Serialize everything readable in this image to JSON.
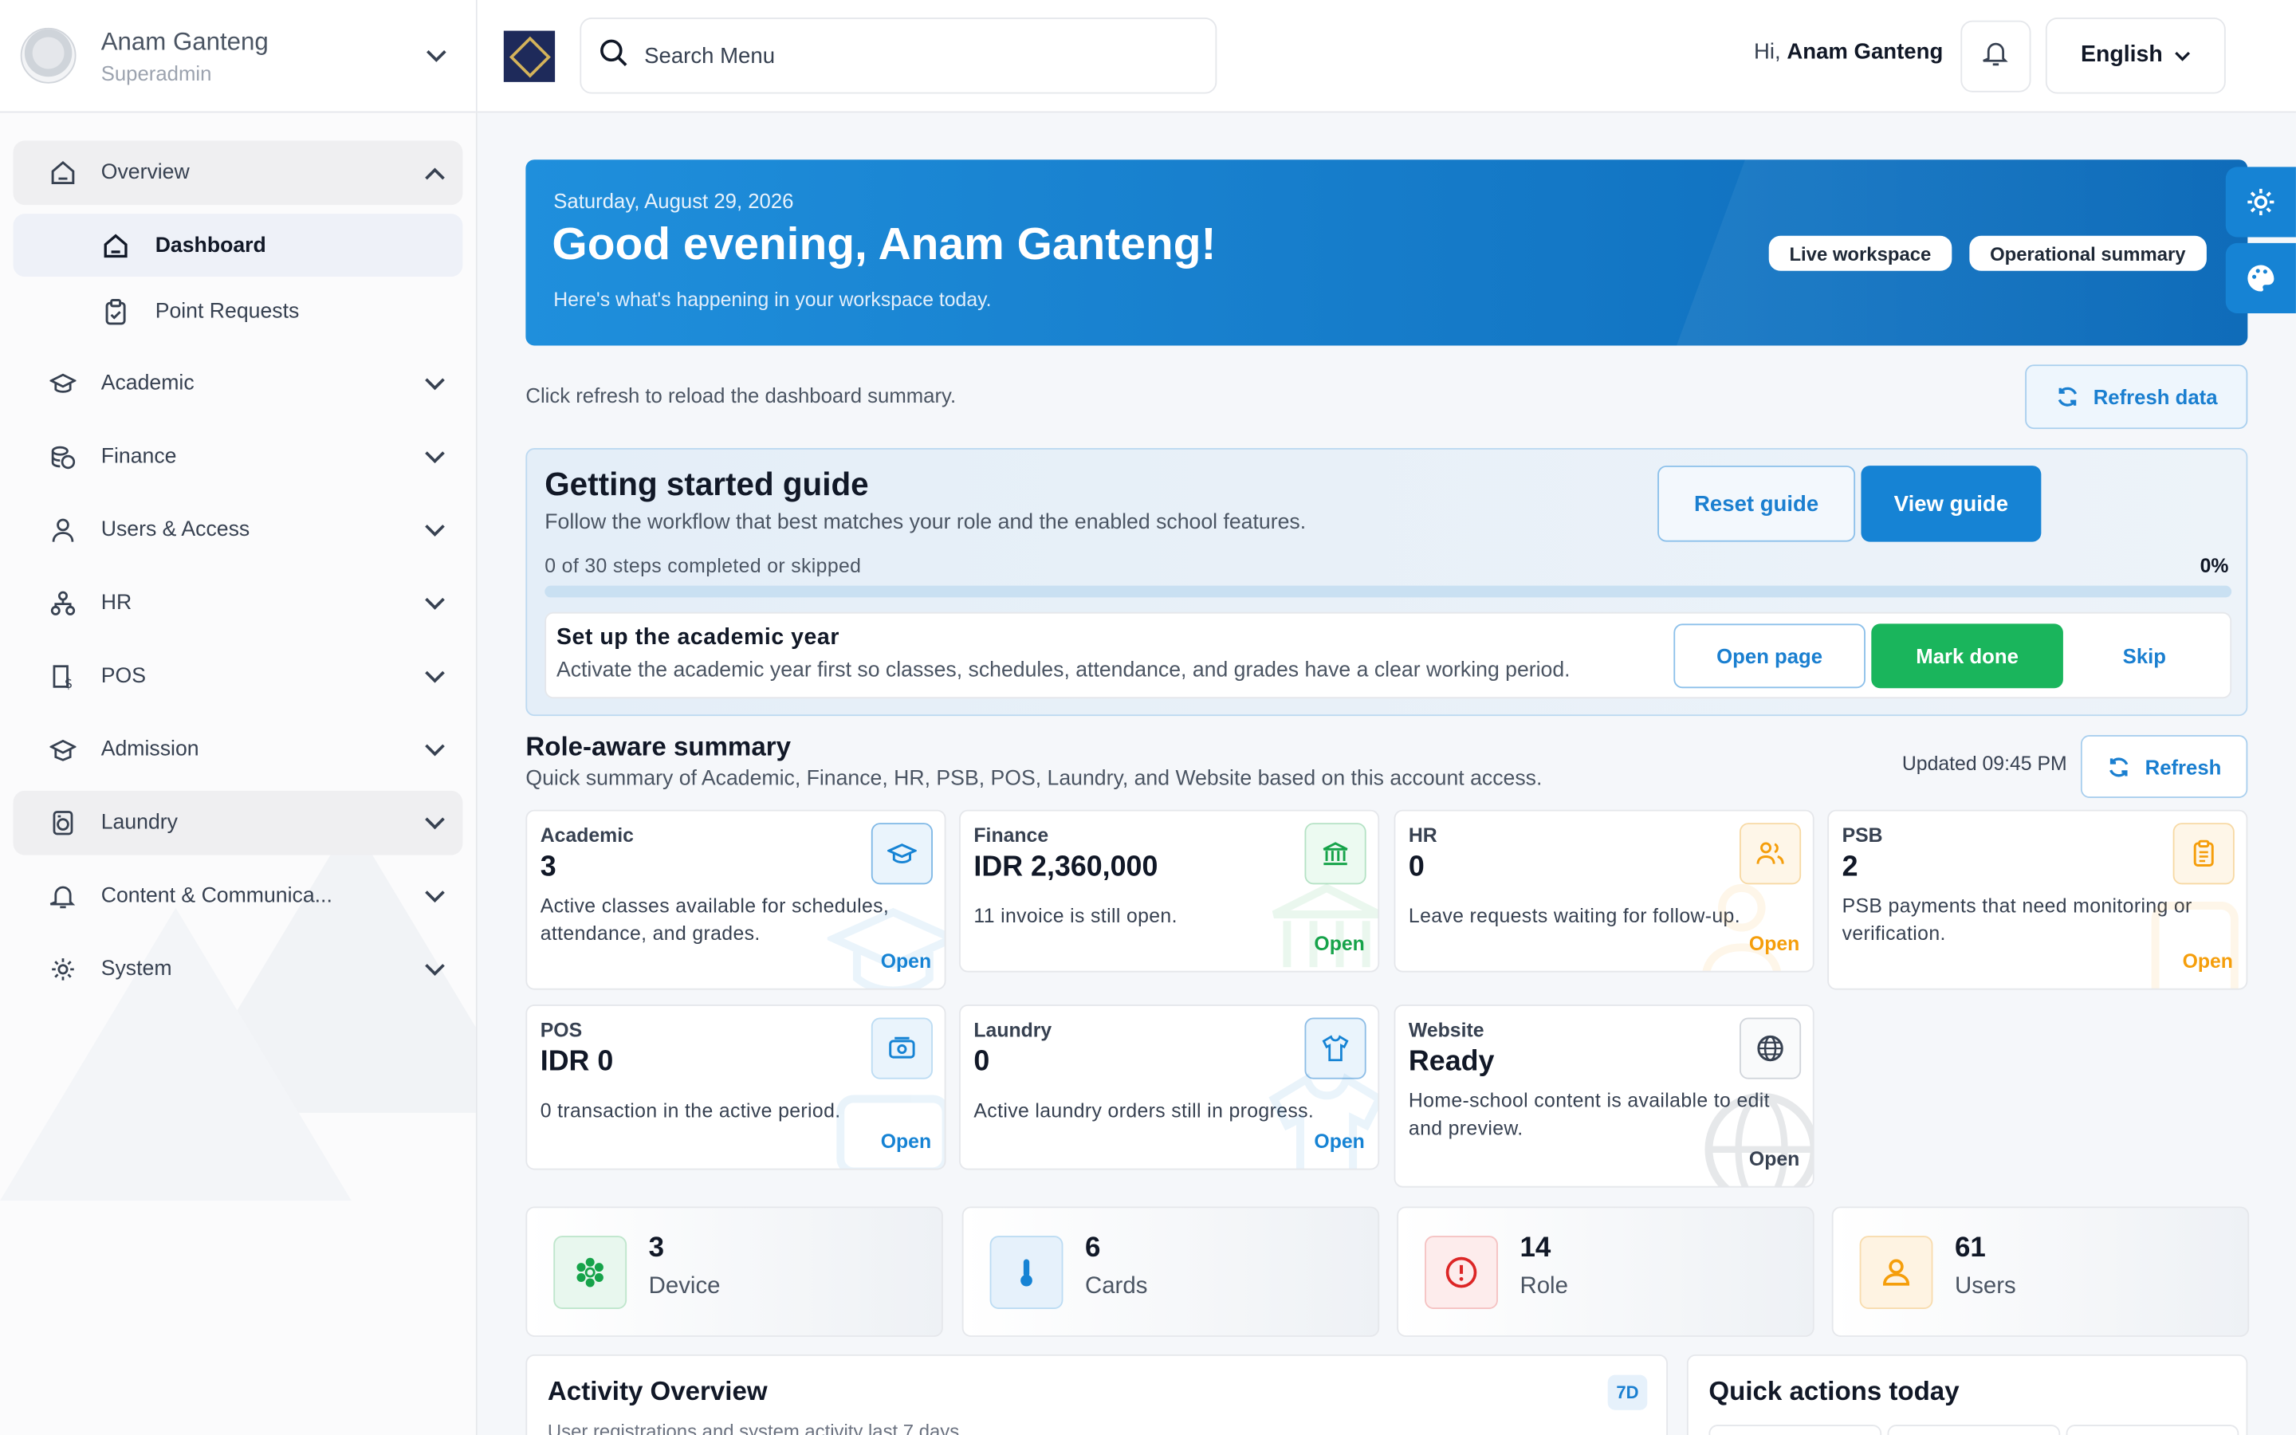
{
  "user": {
    "name": "Anam Ganteng",
    "role": "Superadmin"
  },
  "sidebar": {
    "overview": {
      "label": "Overview",
      "icon": "home-icon"
    },
    "sub_items": [
      {
        "label": "Dashboard",
        "icon": "home-icon",
        "active": true
      },
      {
        "label": "Point Requests",
        "icon": "clipboard-check-icon",
        "active": false
      }
    ],
    "items": [
      {
        "label": "Academic",
        "icon": "graduation-cap-icon"
      },
      {
        "label": "Finance",
        "icon": "coins-icon"
      },
      {
        "label": "Users & Access",
        "icon": "user-icon"
      },
      {
        "label": "HR",
        "icon": "org-chart-icon"
      },
      {
        "label": "POS",
        "icon": "receipt-dollar-icon"
      },
      {
        "label": "Admission",
        "icon": "school-hat-icon"
      },
      {
        "label": "Laundry",
        "icon": "washing-machine-icon"
      },
      {
        "label": "Content & Communica...",
        "icon": "bell-icon"
      },
      {
        "label": "System",
        "icon": "gear-icon"
      }
    ]
  },
  "topbar": {
    "search_placeholder": "Search Menu",
    "greeting_prefix": "Hi,",
    "greeting_name": "Anam Ganteng",
    "language": "English"
  },
  "hero": {
    "date": "Saturday, August 29, 2026",
    "title": "Good evening, Anam Ganteng!",
    "subtitle": "Here's what's happening in your workspace today.",
    "badges": [
      "Live workspace",
      "Operational summary"
    ]
  },
  "refresh": {
    "hint": "Click refresh to reload the dashboard summary.",
    "button": "Refresh data"
  },
  "guide": {
    "title": "Getting started guide",
    "subtitle": "Follow the workflow that best matches your role and the enabled school features.",
    "reset_label": "Reset guide",
    "view_label": "View guide",
    "progress_text": "0 of 30 steps completed or skipped",
    "progress_percent": "0%",
    "progress_value": 0,
    "step": {
      "title": "Set up the academic year",
      "description": "Activate the academic year first so classes, schedules, attendance, and grades have a clear working period.",
      "open_label": "Open page",
      "done_label": "Mark done",
      "skip_label": "Skip"
    }
  },
  "summary": {
    "title": "Role-aware summary",
    "subtitle": "Quick summary of Academic, Finance, HR, PSB, POS, Laundry, and Website based on this account access.",
    "updated": "Updated 09:45 PM",
    "refresh_label": "Refresh",
    "cards": [
      {
        "label": "Academic",
        "value": "3",
        "desc": "Active classes available for schedules, attendance, and grades.",
        "open": "Open",
        "icon": "graduation-cap-icon",
        "color": "#1683d4"
      },
      {
        "label": "Finance",
        "value": "IDR 2,360,000",
        "desc": "11 invoice is still open.",
        "open": "Open",
        "icon": "bank-icon",
        "color": "#16a34a"
      },
      {
        "label": "HR",
        "value": "0",
        "desc": "Leave requests waiting for follow-up.",
        "open": "Open",
        "icon": "users-icon",
        "color": "#f59e0b"
      },
      {
        "label": "PSB",
        "value": "2",
        "desc": "PSB payments that need monitoring or verification.",
        "open": "Open",
        "icon": "clipboard-list-icon",
        "color": "#f59e0b"
      },
      {
        "label": "POS",
        "value": "IDR 0",
        "desc": "0 transaction in the active period.",
        "open": "Open",
        "icon": "cash-register-icon",
        "color": "#1683d4"
      },
      {
        "label": "Laundry",
        "value": "0",
        "desc": "Active laundry orders still in progress.",
        "open": "Open",
        "icon": "shirt-icon",
        "color": "#1683d4"
      },
      {
        "label": "Website",
        "value": "Ready",
        "desc": "Home-school content is available to edit and preview.",
        "open": "Open",
        "icon": "globe-icon",
        "color": "#374151"
      }
    ]
  },
  "stats": [
    {
      "value": "3",
      "label": "Device",
      "icon": "gear-flower-icon",
      "color": "#16a34a"
    },
    {
      "value": "6",
      "label": "Cards",
      "icon": "thermometer-icon",
      "color": "#1683d4"
    },
    {
      "value": "14",
      "label": "Role",
      "icon": "alert-circle-icon",
      "color": "#dc2626"
    },
    {
      "value": "61",
      "label": "Users",
      "icon": "user-icon",
      "color": "#f59e0b"
    }
  ],
  "activity": {
    "title": "Activity Overview",
    "range": "7D",
    "subtitle": "User registrations and system activity last 7 days"
  },
  "quick_actions": {
    "title": "Quick actions today"
  },
  "colors": {
    "primary": "#1683d4",
    "success": "#1ab55c",
    "warning": "#f59e0b",
    "danger": "#dc2626"
  }
}
